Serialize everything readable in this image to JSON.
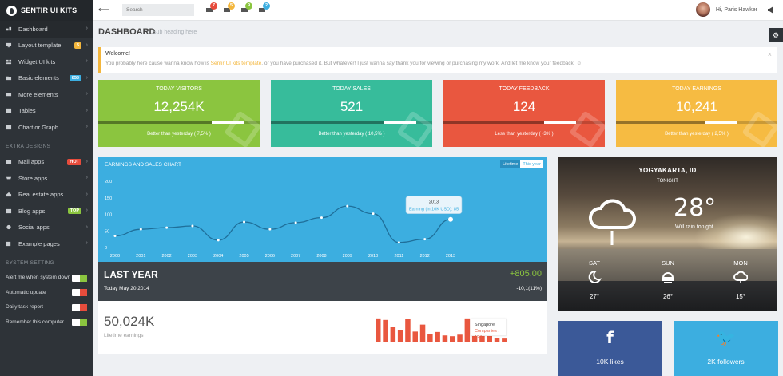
{
  "brand": "SENTIR UI KITS",
  "sidebar": {
    "items": [
      {
        "label": "Dashboard",
        "icon": "dashboard-icon"
      },
      {
        "label": "Layout template",
        "icon": "layout-icon",
        "badge": "5",
        "badge_color": "#f3b63c"
      },
      {
        "label": "Widget UI kits",
        "icon": "widget-icon"
      },
      {
        "label": "Basic elements",
        "icon": "folder-icon",
        "badge": "853",
        "badge_color": "#3caee0"
      },
      {
        "label": "More elements",
        "icon": "plus-icon"
      },
      {
        "label": "Tables",
        "icon": "table-icon"
      },
      {
        "label": "Chart or Graph",
        "icon": "chart-icon"
      }
    ],
    "extra_title": "EXTRA DESIGNS",
    "extra": [
      {
        "label": "Mail apps",
        "icon": "mail-icon",
        "badge": "HOT",
        "badge_color": "#e74c3c"
      },
      {
        "label": "Store apps",
        "icon": "cart-icon"
      },
      {
        "label": "Real estate apps",
        "icon": "home-icon"
      },
      {
        "label": "Blog apps",
        "icon": "blog-icon",
        "badge": "TOP",
        "badge_color": "#8bc53f"
      },
      {
        "label": "Social apps",
        "icon": "globe-icon"
      },
      {
        "label": "Example pages",
        "icon": "pages-icon"
      }
    ],
    "setting_title": "SYSTEM SETTING",
    "settings": [
      {
        "label": "Alert me when system down",
        "on": true
      },
      {
        "label": "Automatic update",
        "on": false
      },
      {
        "label": "Daily task report",
        "on": false
      },
      {
        "label": "Remember this computer",
        "on": true
      }
    ]
  },
  "topbar": {
    "search_placeholder": "Search",
    "notifications": [
      {
        "icon": "bell-icon",
        "count": "7",
        "color": "#e74c3c"
      },
      {
        "icon": "tasks-icon",
        "count": "5",
        "color": "#f3b63c"
      },
      {
        "icon": "mail-icon",
        "count": "9",
        "color": "#8bc53f"
      },
      {
        "icon": "chat-icon",
        "count": "2",
        "color": "#3caee0"
      }
    ],
    "user_greeting": "Hi, Paris Hawker"
  },
  "page": {
    "title": "DASHBOARD",
    "subtitle": "Sub heading here"
  },
  "alert": {
    "heading": "Welcome!",
    "text_before": "You probably here cause wanna know how is ",
    "link": "Sentir UI kits template",
    "text_after": ", or you have purchased it. But whatever! I just wanna say thank you for viewing or purchasing my work. And let me know your feedback! ☺"
  },
  "stats": [
    {
      "label": "TODAY VISITORS",
      "value": "12,254K",
      "compare": "Better than yesterday ( 7,5% )",
      "color": "#8bc53f",
      "progress": 0.9
    },
    {
      "label": "TODAY SALES",
      "value": "521",
      "compare": "Better than yesterday ( 10,5% )",
      "color": "#37bc9b",
      "progress": 0.9
    },
    {
      "label": "TODAY FEEDBACK",
      "value": "124",
      "compare": "Less than yesterday ( -3% )",
      "color": "#e9573f",
      "progress": 0.82
    },
    {
      "label": "TODAY EARNINGS",
      "value": "10,241",
      "compare": "Better than yesterday ( 2,5% )",
      "color": "#f6bb42",
      "progress": 0.75
    }
  ],
  "chart_card": {
    "title": "EARNINGS AND SALES CHART",
    "tabs": [
      "Lifetime",
      "This year"
    ],
    "tooltip_year": "2013",
    "tooltip_text": "Earning (in 10K USD): 85"
  },
  "chart_data": {
    "type": "line",
    "x": [
      "2000",
      "2001",
      "2002",
      "2003",
      "2004",
      "2005",
      "2006",
      "2007",
      "2008",
      "2009",
      "2010",
      "2011",
      "2012",
      "2013"
    ],
    "series": [
      {
        "values": [
          35,
          55,
          60,
          65,
          22,
          77,
          55,
          75,
          90,
          125,
          102,
          15,
          25,
          85
        ]
      }
    ],
    "yticks": [
      0,
      50,
      100,
      150,
      200
    ],
    "ylim": [
      0,
      200
    ]
  },
  "last_year": {
    "title": "LAST YEAR",
    "date": "Today May 20 2014",
    "amount": "+805.00",
    "change": "-10,1(11%)"
  },
  "earnings": {
    "value": "50,024K",
    "label": "Lifetime earnings",
    "bars": [
      60,
      56,
      38,
      30,
      58,
      26,
      44,
      20,
      25,
      16,
      14,
      18,
      60,
      55,
      50,
      16,
      10,
      8
    ],
    "tip_name": "Singapore",
    "tip_value": "Companies : 124"
  },
  "weather": {
    "city": "YOGYAKARTA, ID",
    "period": "TONIGHT",
    "temp": "28°",
    "desc": "Will rain tonight",
    "forecast": [
      {
        "day": "SAT",
        "temp": "27°",
        "icon": "moon-icon"
      },
      {
        "day": "SUN",
        "temp": "26°",
        "icon": "sun-haze-icon"
      },
      {
        "day": "MON",
        "temp": "15°",
        "icon": "cloud-icon"
      }
    ]
  },
  "social": [
    {
      "label": "10K likes",
      "icon": "facebook-icon",
      "glyph": "f",
      "color": "#3b5998"
    },
    {
      "label": "2K followers",
      "icon": "twitter-icon",
      "glyph": "🐦",
      "color": "#3caee0"
    }
  ]
}
